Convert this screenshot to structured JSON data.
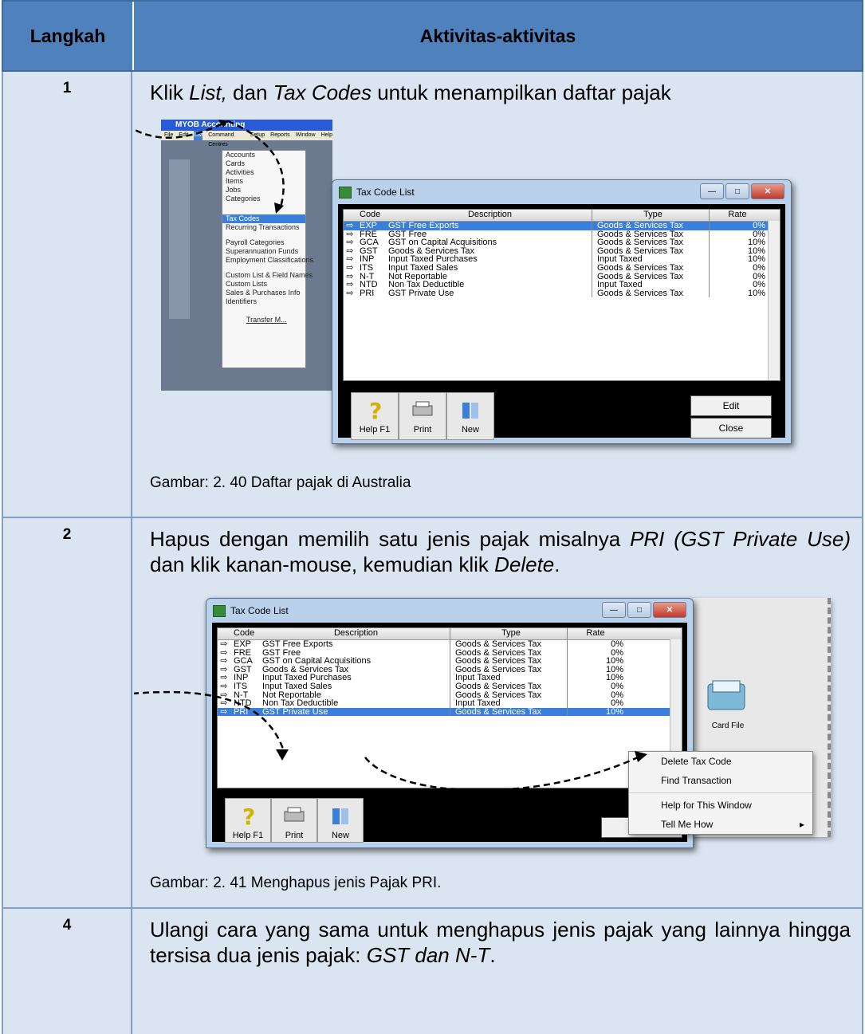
{
  "header": {
    "col1": "Langkah",
    "col2": "Aktivitas-aktivitas"
  },
  "steps": [
    {
      "num": "1",
      "text_pre": "Klik ",
      "list": "List,",
      "text_mid": " dan ",
      "tax": "Tax Codes",
      "text_post": " untuk menampilkan daftar pajak",
      "caption": "Gambar: 2. 40 Daftar pajak di Australia"
    },
    {
      "num": "2",
      "text_pre": "Hapus dengan memilih satu jenis pajak misalnya ",
      "pri": "PRI (GST Private Use)",
      "text_mid": " dan klik kanan-mouse, kemudian klik ",
      "del": "Delete",
      "text_post": ".",
      "caption": "Gambar: 2. 41 Menghapus jenis Pajak PRI."
    },
    {
      "num": "4",
      "text_pre": "Ulangi cara yang sama untuk menghapus jenis pajak yang lainnya hingga tersisa dua jenis pajak: ",
      "em": "GST dan N-T",
      "text_post": "."
    }
  ],
  "myob": {
    "title": "MYOB Accounting",
    "menubar": [
      "File",
      "Edit",
      "List",
      "Command Centres",
      "Setup",
      "Reports",
      "Window",
      "Help"
    ],
    "menu_items": [
      "Accounts",
      "Cards",
      "Activities",
      "Items",
      "Jobs",
      "Categories",
      "Tax Codes",
      "Recurring Transactions",
      "Payroll Categories",
      "Superannuation Funds",
      "Employment Classifications",
      "Custom List & Field Names",
      "Custom Lists",
      "Sales & Purchases Info",
      "Identifiers",
      "Transfer M..."
    ]
  },
  "taxwin": {
    "title": "Tax Code List",
    "columns": [
      "Code",
      "Description",
      "Type",
      "Rate"
    ],
    "rows": [
      {
        "code": "EXP",
        "desc": "GST Free Exports",
        "type": "Goods & Services Tax",
        "rate": "0%"
      },
      {
        "code": "FRE",
        "desc": "GST Free",
        "type": "Goods & Services Tax",
        "rate": "0%"
      },
      {
        "code": "GCA",
        "desc": "GST on Capital Acquisitions",
        "type": "Goods & Services Tax",
        "rate": "10%"
      },
      {
        "code": "GST",
        "desc": "Goods & Services Tax",
        "type": "Goods & Services Tax",
        "rate": "10%"
      },
      {
        "code": "INP",
        "desc": "Input Taxed Purchases",
        "type": "Input Taxed",
        "rate": "10%"
      },
      {
        "code": "ITS",
        "desc": "Input Taxed Sales",
        "type": "Goods & Services Tax",
        "rate": "0%"
      },
      {
        "code": "N-T",
        "desc": "Not Reportable",
        "type": "Goods & Services Tax",
        "rate": "0%"
      },
      {
        "code": "NTD",
        "desc": "Non Tax Deductible",
        "type": "Input Taxed",
        "rate": "0%"
      },
      {
        "code": "PRI",
        "desc": "GST Private Use",
        "type": "Goods & Services Tax",
        "rate": "10%"
      }
    ],
    "buttons": {
      "help": "Help F1",
      "print": "Print",
      "new": "New",
      "edit": "Edit",
      "close": "Close"
    }
  },
  "context_menu": [
    "Delete Tax Code",
    "Find Transaction",
    "Help for This Window",
    "Tell Me How"
  ],
  "side": {
    "card_file": "Card File"
  }
}
